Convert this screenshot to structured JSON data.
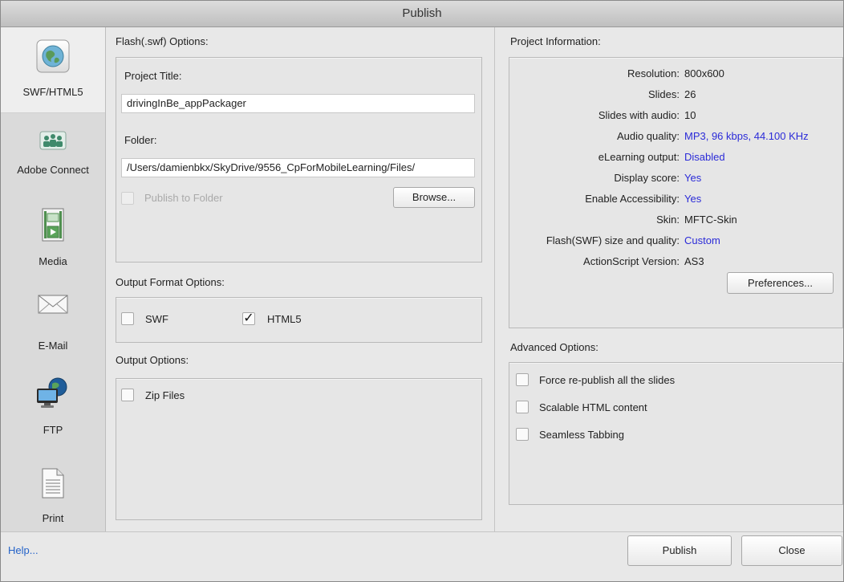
{
  "window": {
    "title": "Publish"
  },
  "sidebar": {
    "items": [
      {
        "label": "SWF/HTML5",
        "icon": "globe-icon"
      },
      {
        "label": "Adobe Connect",
        "icon": "adobe-connect-icon"
      },
      {
        "label": "Media",
        "icon": "media-icon"
      },
      {
        "label": "E-Mail",
        "icon": "envelope-icon"
      },
      {
        "label": "FTP",
        "icon": "ftp-icon"
      },
      {
        "label": "Print",
        "icon": "document-icon"
      }
    ]
  },
  "flash_options": {
    "heading": "Flash(.swf) Options:",
    "project_title_label": "Project Title:",
    "project_title_value": "drivingInBe_appPackager",
    "folder_label": "Folder:",
    "folder_value": "/Users/damienbkx/SkyDrive/9556_CpForMobileLearning/Files/",
    "publish_to_folder_label": "Publish to Folder",
    "browse_label": "Browse..."
  },
  "output_format": {
    "heading": "Output Format Options:",
    "swf_label": "SWF",
    "swf_checked": false,
    "html5_label": "HTML5",
    "html5_checked": true,
    "check_mark": "✓"
  },
  "output_options": {
    "heading": "Output Options:",
    "zip_label": "Zip Files",
    "zip_checked": false
  },
  "project_info": {
    "heading": "Project Information:",
    "rows": [
      {
        "key": "Resolution:",
        "value": "800x600",
        "link": false
      },
      {
        "key": "Slides:",
        "value": "26",
        "link": false
      },
      {
        "key": "Slides with audio:",
        "value": "10",
        "link": false
      },
      {
        "key": "Audio quality:",
        "value": "MP3, 96 kbps, 44.100 KHz",
        "link": true
      },
      {
        "key": "eLearning output:",
        "value": "Disabled",
        "link": true
      },
      {
        "key": "Display score:",
        "value": "Yes",
        "link": true
      },
      {
        "key": "Enable Accessibility:",
        "value": "Yes",
        "link": true
      },
      {
        "key": "Skin:",
        "value": "MFTC-Skin",
        "link": false
      },
      {
        "key": "Flash(SWF) size and quality:",
        "value": "Custom",
        "link": true
      },
      {
        "key": "ActionScript Version:",
        "value": "AS3",
        "link": false
      }
    ],
    "preferences_label": "Preferences..."
  },
  "advanced_options": {
    "heading": "Advanced Options:",
    "items": [
      {
        "label": "Force re-publish all the slides",
        "checked": false
      },
      {
        "label": "Scalable HTML content",
        "checked": false
      },
      {
        "label": "Seamless Tabbing",
        "checked": false
      }
    ]
  },
  "footer": {
    "help_label": "Help...",
    "publish_label": "Publish",
    "close_label": "Close"
  },
  "colors": {
    "link": "#2b2bd8",
    "help_link": "#2563c9",
    "background": "#e8e8e8",
    "sidebar": "#dadada"
  }
}
